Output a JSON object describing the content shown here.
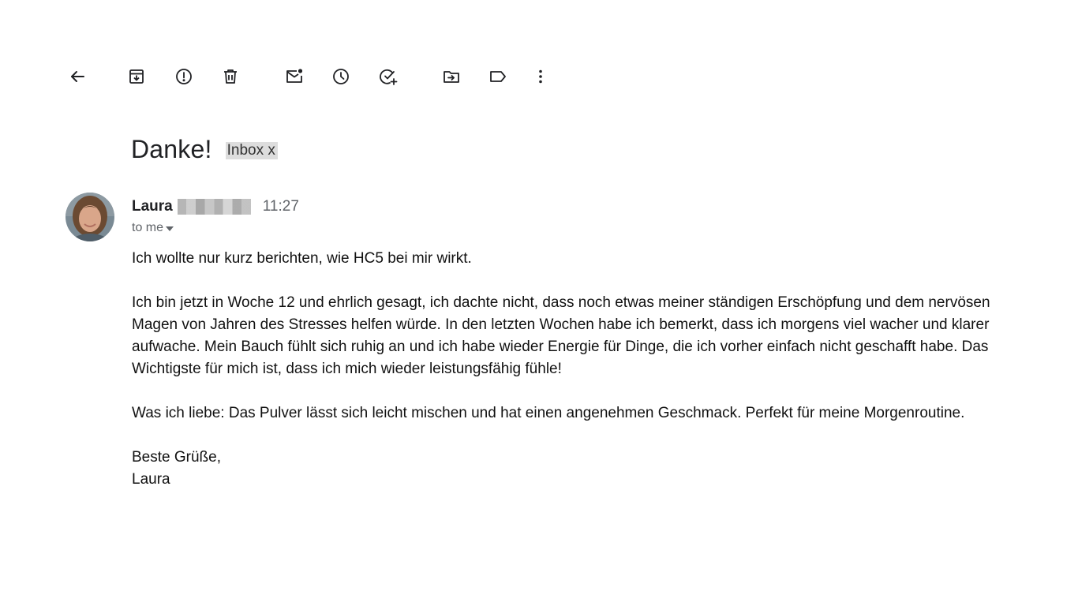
{
  "toolbar": {
    "buttons": [
      {
        "icon": "back-arrow-icon"
      },
      {
        "icon": "archive-icon"
      },
      {
        "icon": "report-spam-icon"
      },
      {
        "icon": "delete-icon"
      },
      {
        "icon": "mark-unread-icon"
      },
      {
        "icon": "snooze-icon"
      },
      {
        "icon": "add-to-tasks-icon"
      },
      {
        "icon": "move-to-icon"
      },
      {
        "icon": "label-icon"
      },
      {
        "icon": "more-vert-icon"
      }
    ]
  },
  "message": {
    "subject": "Danke!",
    "label_chip": "Inbox x",
    "sender_name": "Laura",
    "time": "11:27",
    "recipient": "to me",
    "paragraphs": [
      "Ich wollte nur kurz berichten, wie HC5 bei mir wirkt.",
      "Ich bin jetzt in Woche 12 und ehrlich gesagt, ich dachte nicht, dass noch etwas meiner ständigen Erschöpfung und dem nervösen Magen von Jahren des Stresses helfen würde. In den letzten Wochen habe ich bemerkt, dass ich morgens viel wacher und klarer aufwache. Mein Bauch fühlt sich ruhig an und ich habe wieder Energie für Dinge, die ich vorher einfach nicht geschafft habe. Das Wichtigste für mich ist, dass ich mich wieder leistungsfähig fühle!",
      "Was ich liebe: Das Pulver lässt sich leicht mischen und hat einen angenehmen Geschmack. Perfekt für meine Morgenroutine."
    ],
    "closing": "Beste Grüße,",
    "signature": "Laura"
  },
  "colors": {
    "icon": "#202124",
    "secondary_text": "#5f6368",
    "label_chip_bg": "#dddddd"
  }
}
